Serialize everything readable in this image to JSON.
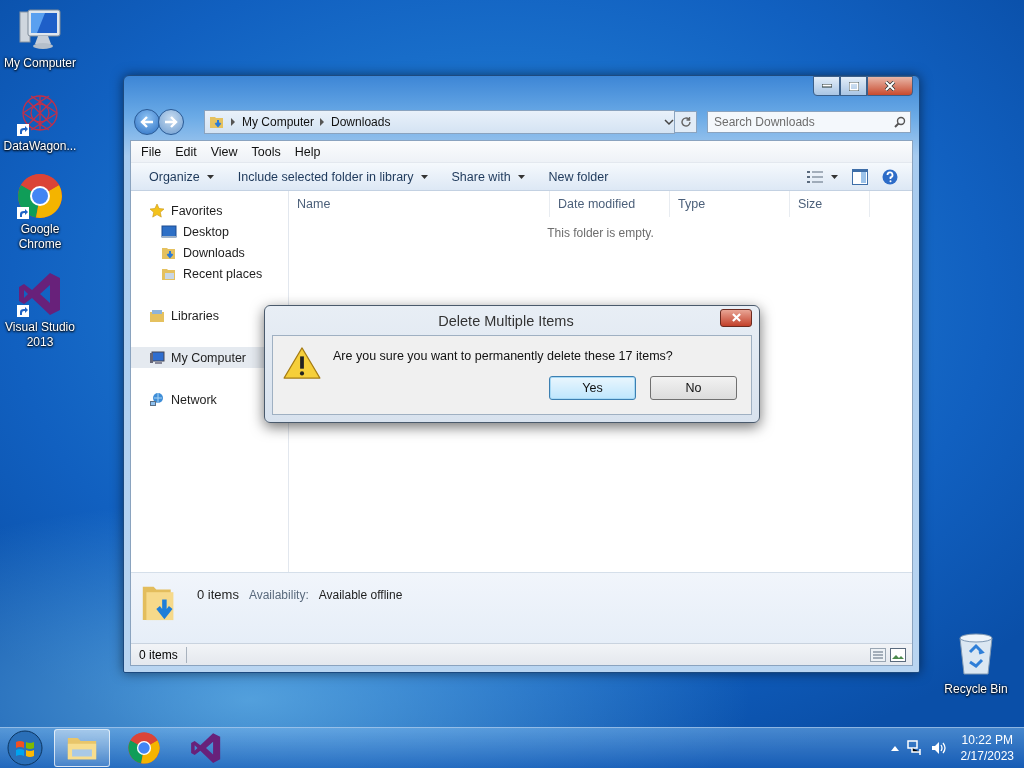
{
  "desktop_icons": [
    {
      "label": "My Computer",
      "kind": "computer",
      "shortcut": false
    },
    {
      "label": "DataWagon...",
      "kind": "starburst",
      "shortcut": true
    },
    {
      "label": "Google Chrome",
      "kind": "browser",
      "shortcut": true
    },
    {
      "label": "Visual Studio 2013",
      "kind": "studio",
      "shortcut": true
    }
  ],
  "recycle_bin": {
    "label": "Recycle Bin",
    "kind": "bin"
  },
  "explorer": {
    "address": [
      "My Computer",
      "Downloads"
    ],
    "search": {
      "placeholder": "Search Downloads"
    },
    "menu": [
      "File",
      "Edit",
      "View",
      "Tools",
      "Help"
    ],
    "toolbar": [
      {
        "label": "Organize",
        "dropdown": true
      },
      {
        "label": "Include selected folder in library",
        "dropdown": true
      },
      {
        "label": "Share with",
        "dropdown": true
      },
      {
        "label": "New folder",
        "dropdown": false
      }
    ],
    "nav": [
      {
        "label": "Favorites",
        "kind": "star",
        "selected": false,
        "children": [
          {
            "label": "Desktop",
            "kind": "desktop",
            "selected": false
          },
          {
            "label": "Downloads",
            "kind": "downloads",
            "selected": false
          },
          {
            "label": "Recent places",
            "kind": "recent",
            "selected": false
          }
        ]
      },
      {
        "label": "Libraries",
        "kind": "library",
        "selected": false
      },
      {
        "label": "My Computer",
        "kind": "computer",
        "selected": true
      },
      {
        "label": "Network",
        "kind": "network",
        "selected": false
      }
    ],
    "columns": [
      "Name",
      "Date modified",
      "Type",
      "Size"
    ],
    "empty_message": "This folder is empty.",
    "details": {
      "count": "0 items",
      "availability_label": "Availability:",
      "availability": "Available offline"
    },
    "status_bar": "0 items"
  },
  "dialog": {
    "title": "Delete Multiple Items",
    "message": "Are you sure you want to permanently delete these 17 items?",
    "buttons": [
      {
        "label": "Yes",
        "default": true
      },
      {
        "label": "No",
        "default": false
      }
    ]
  },
  "taskbar": {
    "apps": [
      {
        "kind": "explorer",
        "active": true
      },
      {
        "kind": "browser",
        "active": false
      },
      {
        "kind": "studio",
        "active": false
      }
    ],
    "time": "10:22 PM",
    "date": "2/17/2023"
  }
}
